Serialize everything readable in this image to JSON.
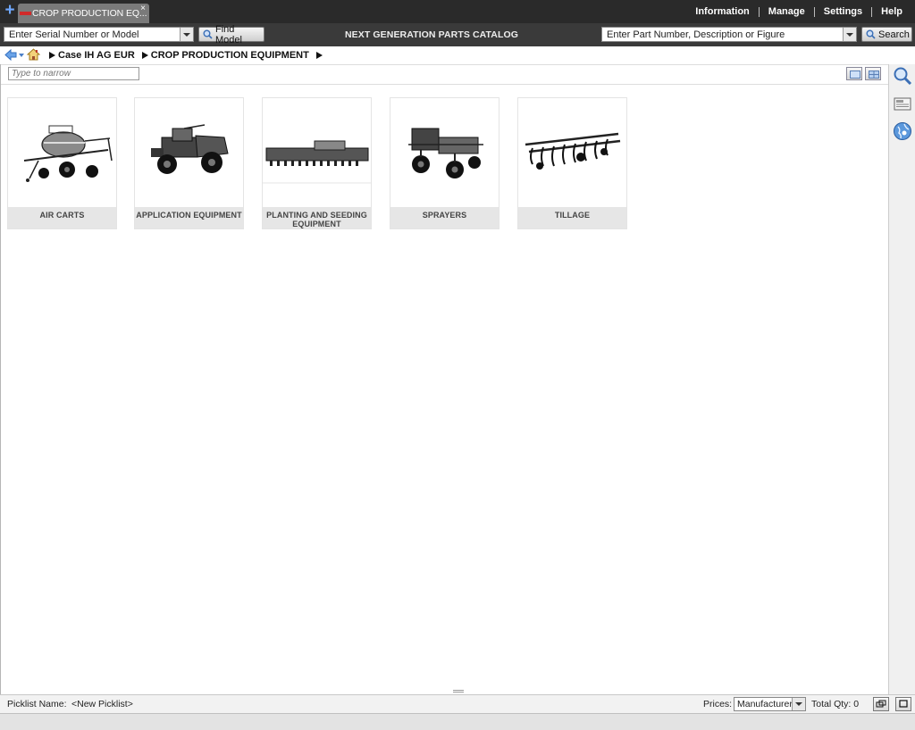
{
  "tab": {
    "title": "CROP PRODUCTION EQ...",
    "close": "×"
  },
  "new_tab": "+",
  "top_menu": [
    "Information",
    "Manage",
    "Settings",
    "Help"
  ],
  "toolbar": {
    "serial_input": "Enter Serial Number or Model",
    "find_model": "Find Model",
    "catalog_title": "NEXT GENERATION PARTS CATALOG",
    "part_input": "Enter Part Number, Description or Figure",
    "search": "Search"
  },
  "breadcrumb": [
    "Case IH AG EUR",
    "CROP PRODUCTION EQUIPMENT"
  ],
  "filter": {
    "placeholder": "Type to narrow"
  },
  "categories": [
    {
      "label": "AIR CARTS",
      "icon": "air-cart-image"
    },
    {
      "label": "APPLICATION EQUIPMENT",
      "icon": "application-equipment-image"
    },
    {
      "label": "PLANTING AND SEEDING EQUIPMENT",
      "icon": "planter-image"
    },
    {
      "label": "SPRAYERS",
      "icon": "sprayer-image"
    },
    {
      "label": "TILLAGE",
      "icon": "tillage-image"
    }
  ],
  "picklist": {
    "name_label": "Picklist Name:",
    "name_value": "<New Picklist>",
    "prices_label": "Prices:",
    "prices_value": "Manufacturer",
    "total_qty": "Total Qty: 0"
  }
}
